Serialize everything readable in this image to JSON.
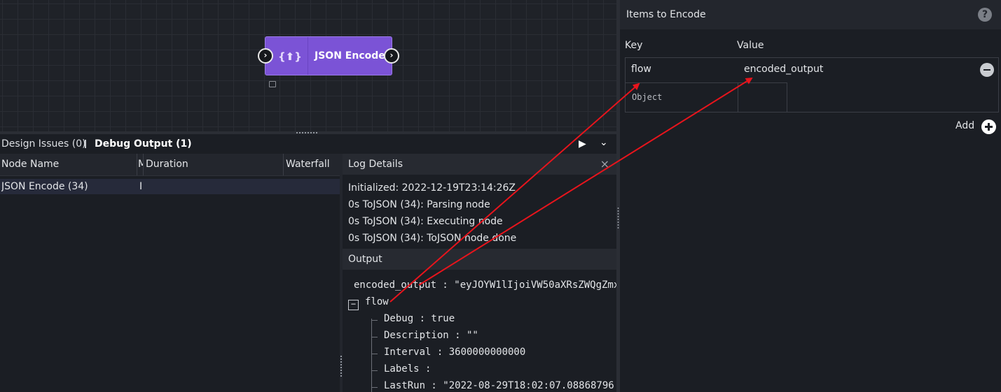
{
  "canvas": {
    "node": {
      "label": "JSON Encode",
      "icon": "json-encode-icon",
      "icon_glyph": "{⬆}",
      "color": "#7b53d6"
    },
    "ports": {
      "input": "chevron-right-icon",
      "output": "chevron-right-icon"
    }
  },
  "bottom_panel": {
    "tabs": {
      "design_issues": "Design Issues (0)",
      "debug_output": "Debug Output (1)"
    },
    "grid": {
      "columns": [
        "Node Name",
        "M",
        "Duration",
        "Waterfall"
      ],
      "rows": [
        {
          "node_name": "JSON Encode (34)",
          "m": "I"
        }
      ]
    },
    "log_details": {
      "title": "Log Details",
      "close": "×",
      "lines": [
        "Initialized: 2022-12-19T23:14:26Z",
        "0s ToJSON (34): Parsing node",
        "0s ToJSON (34): Executing node",
        "0s ToJSON (34): ToJSON node done"
      ]
    },
    "output": {
      "title": "Output",
      "encoded_line": "encoded_output : \"eyJOYW1lIjoiVW50aXRsZWQgZmx",
      "toggle": "−",
      "flow_key": "flow",
      "children": [
        "Debug : true",
        "Description : \"\"",
        "Interval : 3600000000000",
        "Labels :",
        "LastRun : \"2022-08-29T18:02:07.08868796"
      ]
    }
  },
  "right_panel": {
    "title": "Items to Encode",
    "help": "?",
    "columns": {
      "key": "Key",
      "value": "Value"
    },
    "item": {
      "key": "flow",
      "value": "encoded_output",
      "type": "Object"
    },
    "add_label": "Add"
  },
  "annotation_color": "#e8141c"
}
